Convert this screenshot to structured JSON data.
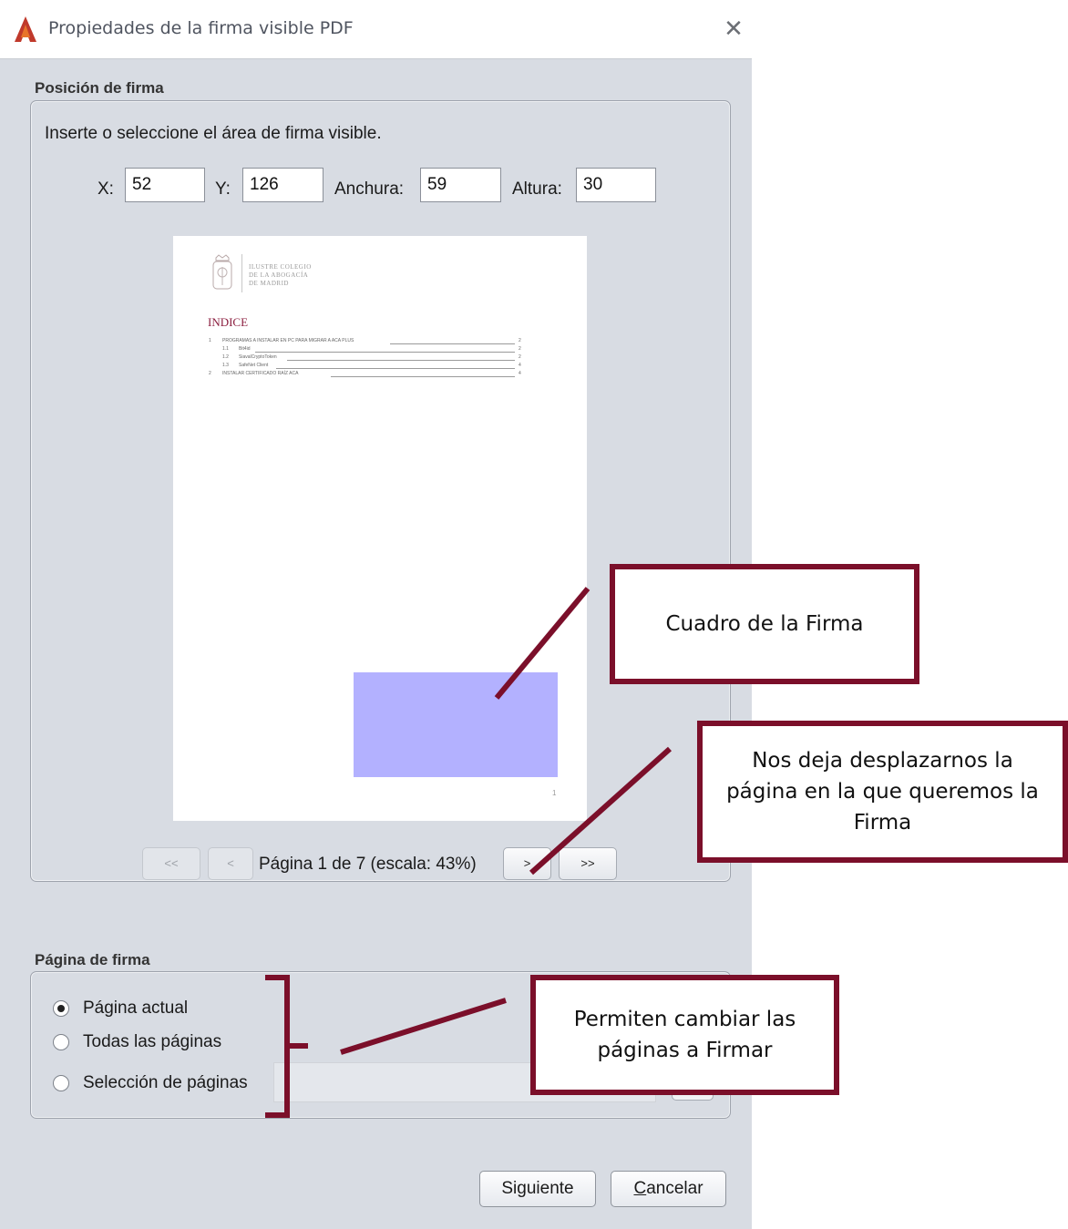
{
  "window": {
    "title": "Propiedades de la firma visible PDF",
    "close_icon": "close-icon",
    "app_icon": "app-logo-icon"
  },
  "position": {
    "section_label": "Posición de firma",
    "instruction": "Inserte o seleccione el área de firma visible.",
    "x_label": "X:",
    "x_value": "52",
    "y_label": "Y:",
    "y_value": "126",
    "width_label": "Anchura:",
    "width_value": "59",
    "height_label": "Altura:",
    "height_value": "30"
  },
  "preview": {
    "org_lines": [
      "ILUSTRE COLEGIO",
      "DE LA ABOGACÍA",
      "DE MADRID"
    ],
    "index_title": "INDICE",
    "toc": [
      {
        "num": "1",
        "text": "PROGRAMAS A INSTALAR EN PC PARA MIGRAR A ACA PLUS",
        "page": "2"
      },
      {
        "num": "1.1",
        "text": "Bit4id",
        "page": "2"
      },
      {
        "num": "1.2",
        "text": "SiavalCryptoToken",
        "page": "2"
      },
      {
        "num": "1.3",
        "text": "SafeNet Client",
        "page": "4"
      },
      {
        "num": "2",
        "text": "INSTALAR CERTIFICADO RAÍZ ACA",
        "page": "4"
      }
    ],
    "page_number": "1"
  },
  "navigation": {
    "first_label": "<<",
    "prev_label": "<",
    "page_info": "Página 1 de 7 (escala: 43%)",
    "next_label": ">",
    "last_label": ">>"
  },
  "signature_page": {
    "section_label": "Página de firma",
    "options": [
      {
        "label": "Página actual",
        "selected": true
      },
      {
        "label": "Todas las páginas",
        "selected": false
      },
      {
        "label": "Selección de páginas",
        "selected": false
      }
    ],
    "pages_field_value": "",
    "help_icon": "help-icon"
  },
  "buttons": {
    "next": "Siguiente",
    "cancel": "Cancelar"
  },
  "annotations": {
    "signature_box": "Cuadro de la Firma",
    "page_nav": "Nos deja desplazarnos la página en la que queremos la Firma",
    "page_selection": "Permiten cambiar las páginas a Firmar",
    "color": "#7b0f2a"
  },
  "colors": {
    "signature_area": "#b3b1ff",
    "brand_red": "#c0392b",
    "dialog_bg": "#d8dce3"
  }
}
